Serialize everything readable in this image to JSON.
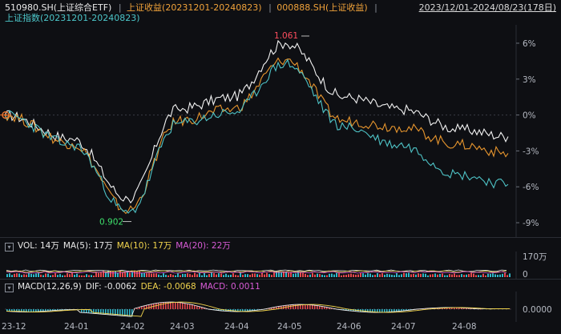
{
  "header": {
    "symbol": "510980.SH(上证综合ETF)",
    "sep1": "|",
    "compare1": "上证收益(20231201-20240823)",
    "sep2": "|",
    "compare2": "000888.SH(上证收益)",
    "sep3": "|",
    "date_range": "2023/12/01-2024/08/23(178日)"
  },
  "subheader": {
    "index_label": "上证指数(20231201-20240823)"
  },
  "colors": {
    "etf": "#f2f2f2",
    "return_index": "#e8962e",
    "sh_index": "#4ec3c6",
    "vol_ma5": "#e9e9e9",
    "vol_ma10": "#f1d44d",
    "vol_ma20": "#d85bd6",
    "up_bar": "#e5484d",
    "down_bar": "#2fb7c9",
    "dif": "#e9e9e9",
    "dea": "#f1d44d"
  },
  "main_chart": {
    "y_ticks": [
      "6%",
      "3%",
      "0%",
      "-3%",
      "-6%",
      "-9%"
    ],
    "annotations": {
      "high_label": "1.061",
      "low_label": "0.902"
    }
  },
  "volume": {
    "vol_label": "VOL: 14万",
    "ma5_label": "MA(5): 17万",
    "ma10_label": "MA(10): 17万",
    "ma20_label": "MA(20): 22万",
    "y_ticks": [
      "170万",
      "0"
    ]
  },
  "macd": {
    "name_label": "MACD(12,26,9)",
    "dif_label": "DIF: -0.0062",
    "dea_label": "DEA: -0.0068",
    "macd_label": "MACD: 0.0011",
    "y_ticks": [
      "0.0000"
    ]
  },
  "x_axis": {
    "labels": [
      "23-12",
      "24-01",
      "24-02",
      "24-03",
      "24-04",
      "24-05",
      "24-06",
      "24-07",
      "24-08"
    ]
  },
  "chart_data": {
    "type": "line",
    "x": [
      "2023-12-01",
      "2024-01-02",
      "2024-02-01",
      "2024-03-01",
      "2024-04-01",
      "2024-05-06",
      "2024-06-03",
      "2024-07-01",
      "2024-08-01",
      "2024-08-23"
    ],
    "series": [
      {
        "name": "510980.SH(上证综合ETF)",
        "color": "#f2f2f2",
        "values": [
          0.0,
          -2.0,
          -7.0,
          0.5,
          1.5,
          6.0,
          1.5,
          0.5,
          -1.2,
          -1.8
        ]
      },
      {
        "name": "上证收益(20231201-20240823)",
        "color": "#e8962e",
        "values": [
          0.0,
          -2.4,
          -8.0,
          -0.5,
          0.5,
          4.6,
          -0.5,
          -1.0,
          -2.5,
          -3.2
        ]
      },
      {
        "name": "上证指数(20231201-20240823)",
        "color": "#4ec3c6",
        "values": [
          0.0,
          -2.5,
          -8.2,
          -0.7,
          0.2,
          4.3,
          -1.0,
          -2.5,
          -5.0,
          -5.8
        ]
      }
    ],
    "y_ticks": [
      "6%",
      "3%",
      "0%",
      "-3%",
      "-6%",
      "-9%"
    ],
    "ylim": [
      -10,
      7
    ],
    "annotations": [
      "1.061",
      "0.902"
    ]
  }
}
